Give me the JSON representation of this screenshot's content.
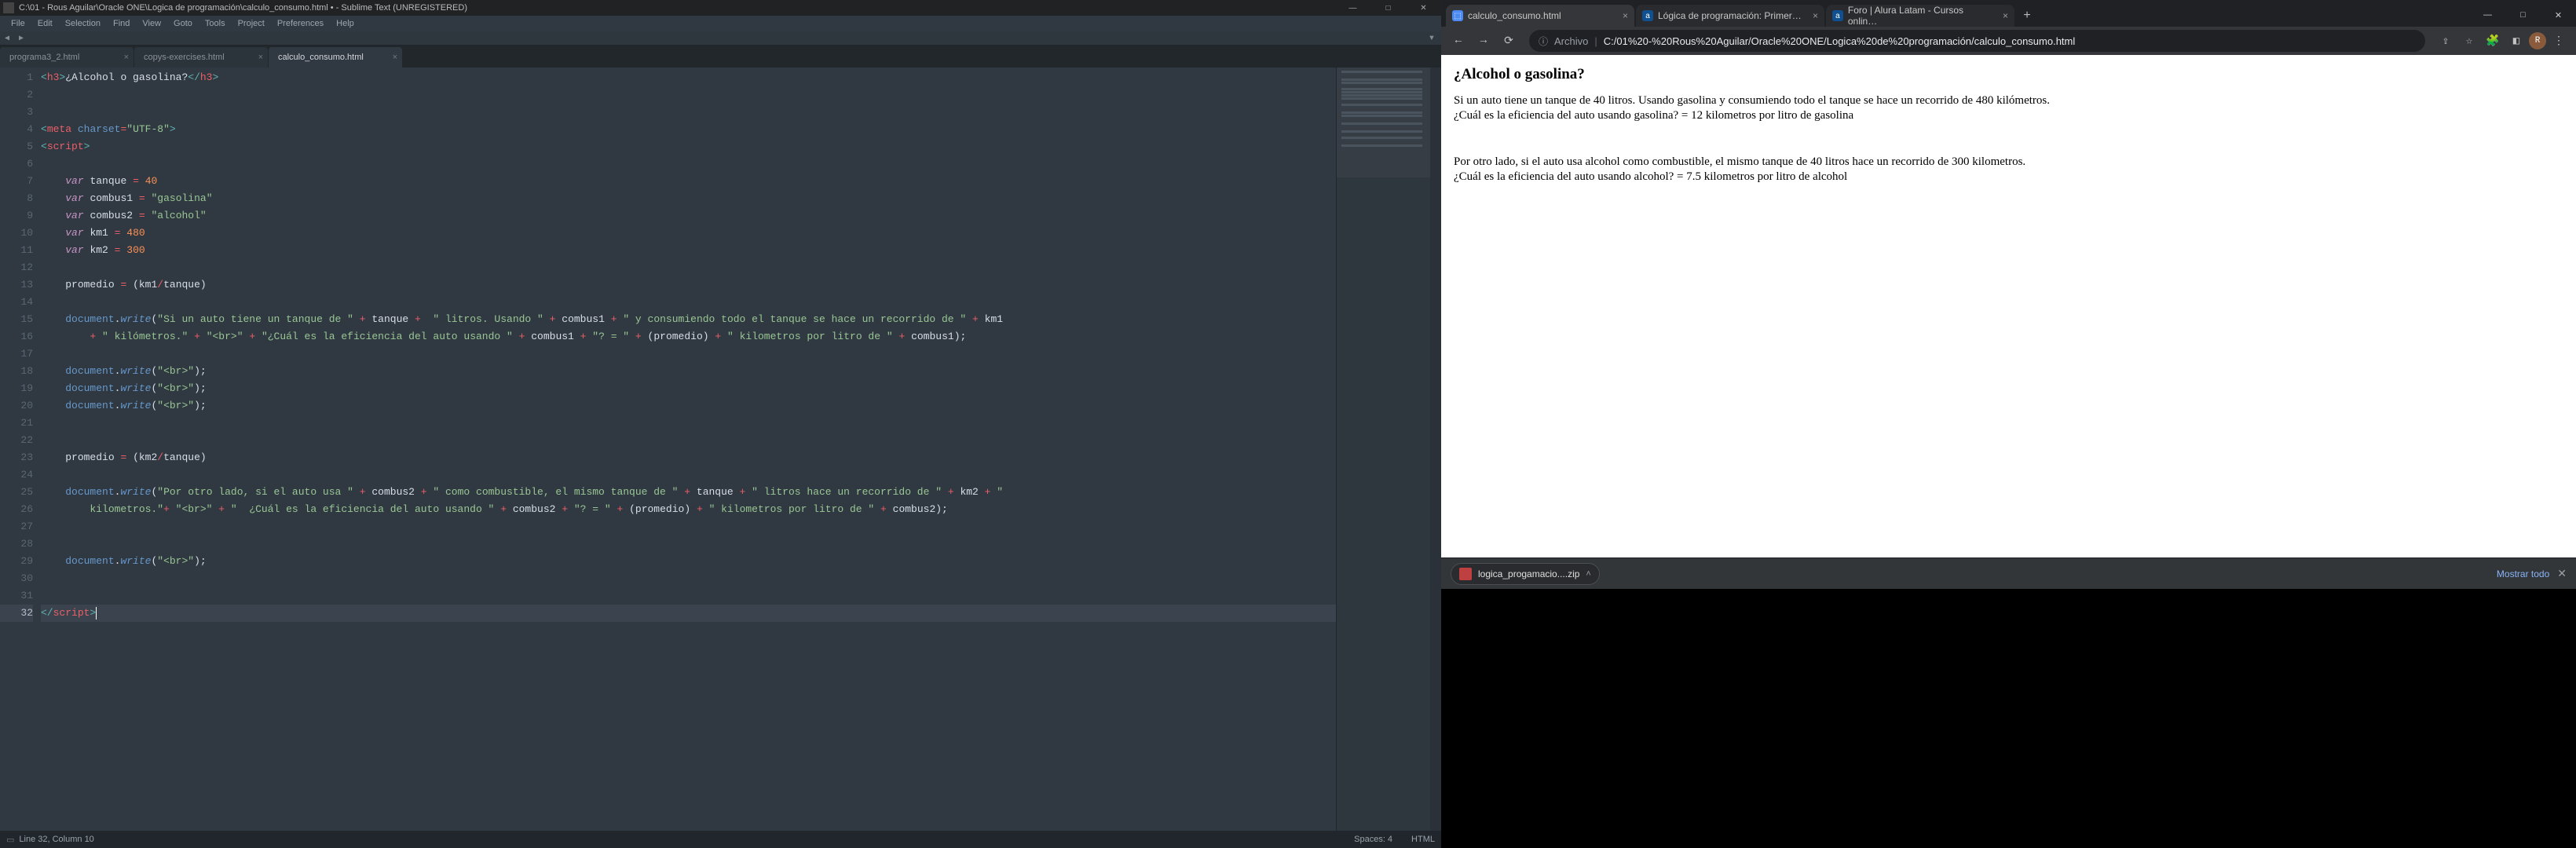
{
  "sublime": {
    "titlebar": "C:\\01 - Rous Aguilar\\Oracle ONE\\Logica de programación\\calculo_consumo.html • - Sublime Text (UNREGISTERED)",
    "menus": [
      "File",
      "Edit",
      "Selection",
      "Find",
      "View",
      "Goto",
      "Tools",
      "Project",
      "Preferences",
      "Help"
    ],
    "tabs": [
      {
        "label": "programa3_2.html",
        "active": false
      },
      {
        "label": "copys-exercises.html",
        "active": false
      },
      {
        "label": "calculo_consumo.html",
        "active": true
      }
    ],
    "status": {
      "left": "Line 32, Column 10",
      "spaces": "Spaces: 4",
      "syntax": "HTML"
    },
    "lineCount": 32,
    "currentLine": 32
  },
  "chrome": {
    "tabs": [
      {
        "label": "calculo_consumo.html",
        "fav": "html",
        "active": true
      },
      {
        "label": "Lógica de programación: Primer…",
        "fav": "alura",
        "active": false
      },
      {
        "label": "Foro | Alura Latam - Cursos onlin…",
        "fav": "alura",
        "active": false
      }
    ],
    "omnibox": {
      "info": "ⓘ",
      "label": "Archivo",
      "url": "C:/01%20-%20Rous%20Aguilar/Oracle%20ONE/Logica%20de%20programación/calculo_consumo.html"
    },
    "page": {
      "title": "¿Alcohol o gasolina?",
      "p1": "Si un auto tiene un tanque de 40 litros. Usando gasolina y consumiendo todo el tanque se hace un recorrido de 480 kilómetros.",
      "p2": "¿Cuál es la eficiencia del auto usando gasolina? = 12 kilometros por litro de gasolina",
      "p3": "Por otro lado, si el auto usa alcohol como combustible, el mismo tanque de 40 litros hace un recorrido de 300 kilometros.",
      "p4": "¿Cuál es la eficiencia del auto usando alcohol? = 7.5 kilometros por litro de alcohol"
    },
    "download": {
      "file": "logica_progamacio....zip",
      "showAll": "Mostrar todo"
    }
  },
  "chart_data": null
}
